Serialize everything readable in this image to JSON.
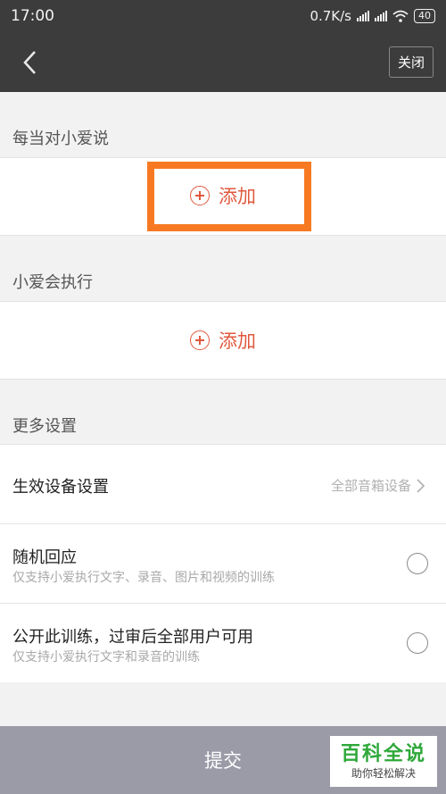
{
  "status_bar": {
    "time": "17:00",
    "net_speed": "0.7K/s",
    "battery": "40"
  },
  "nav": {
    "close_label": "关闭"
  },
  "section1": {
    "title": "每当对小爱说",
    "add_label": "添加"
  },
  "section2": {
    "title": "小爱会执行",
    "add_label": "添加"
  },
  "section3": {
    "title": "更多设置",
    "device_setting": {
      "label": "生效设备设置",
      "value": "全部音箱设备"
    },
    "random_reply": {
      "label": "随机回应",
      "sub": "仅支持小爱执行文字、录音、图片和视频的训练"
    },
    "public_training": {
      "label": "公开此训练，过审后全部用户可用",
      "sub": "仅支持小爱执行文字和录音的训练"
    }
  },
  "submit_label": "提交",
  "watermark": {
    "title": "百科全说",
    "sub": "助你轻松解决"
  },
  "colors": {
    "accent": "#e0593e",
    "highlight": "#f77a23",
    "header_bg": "#3c3c3c",
    "submit_bg": "#9b9ba8"
  }
}
